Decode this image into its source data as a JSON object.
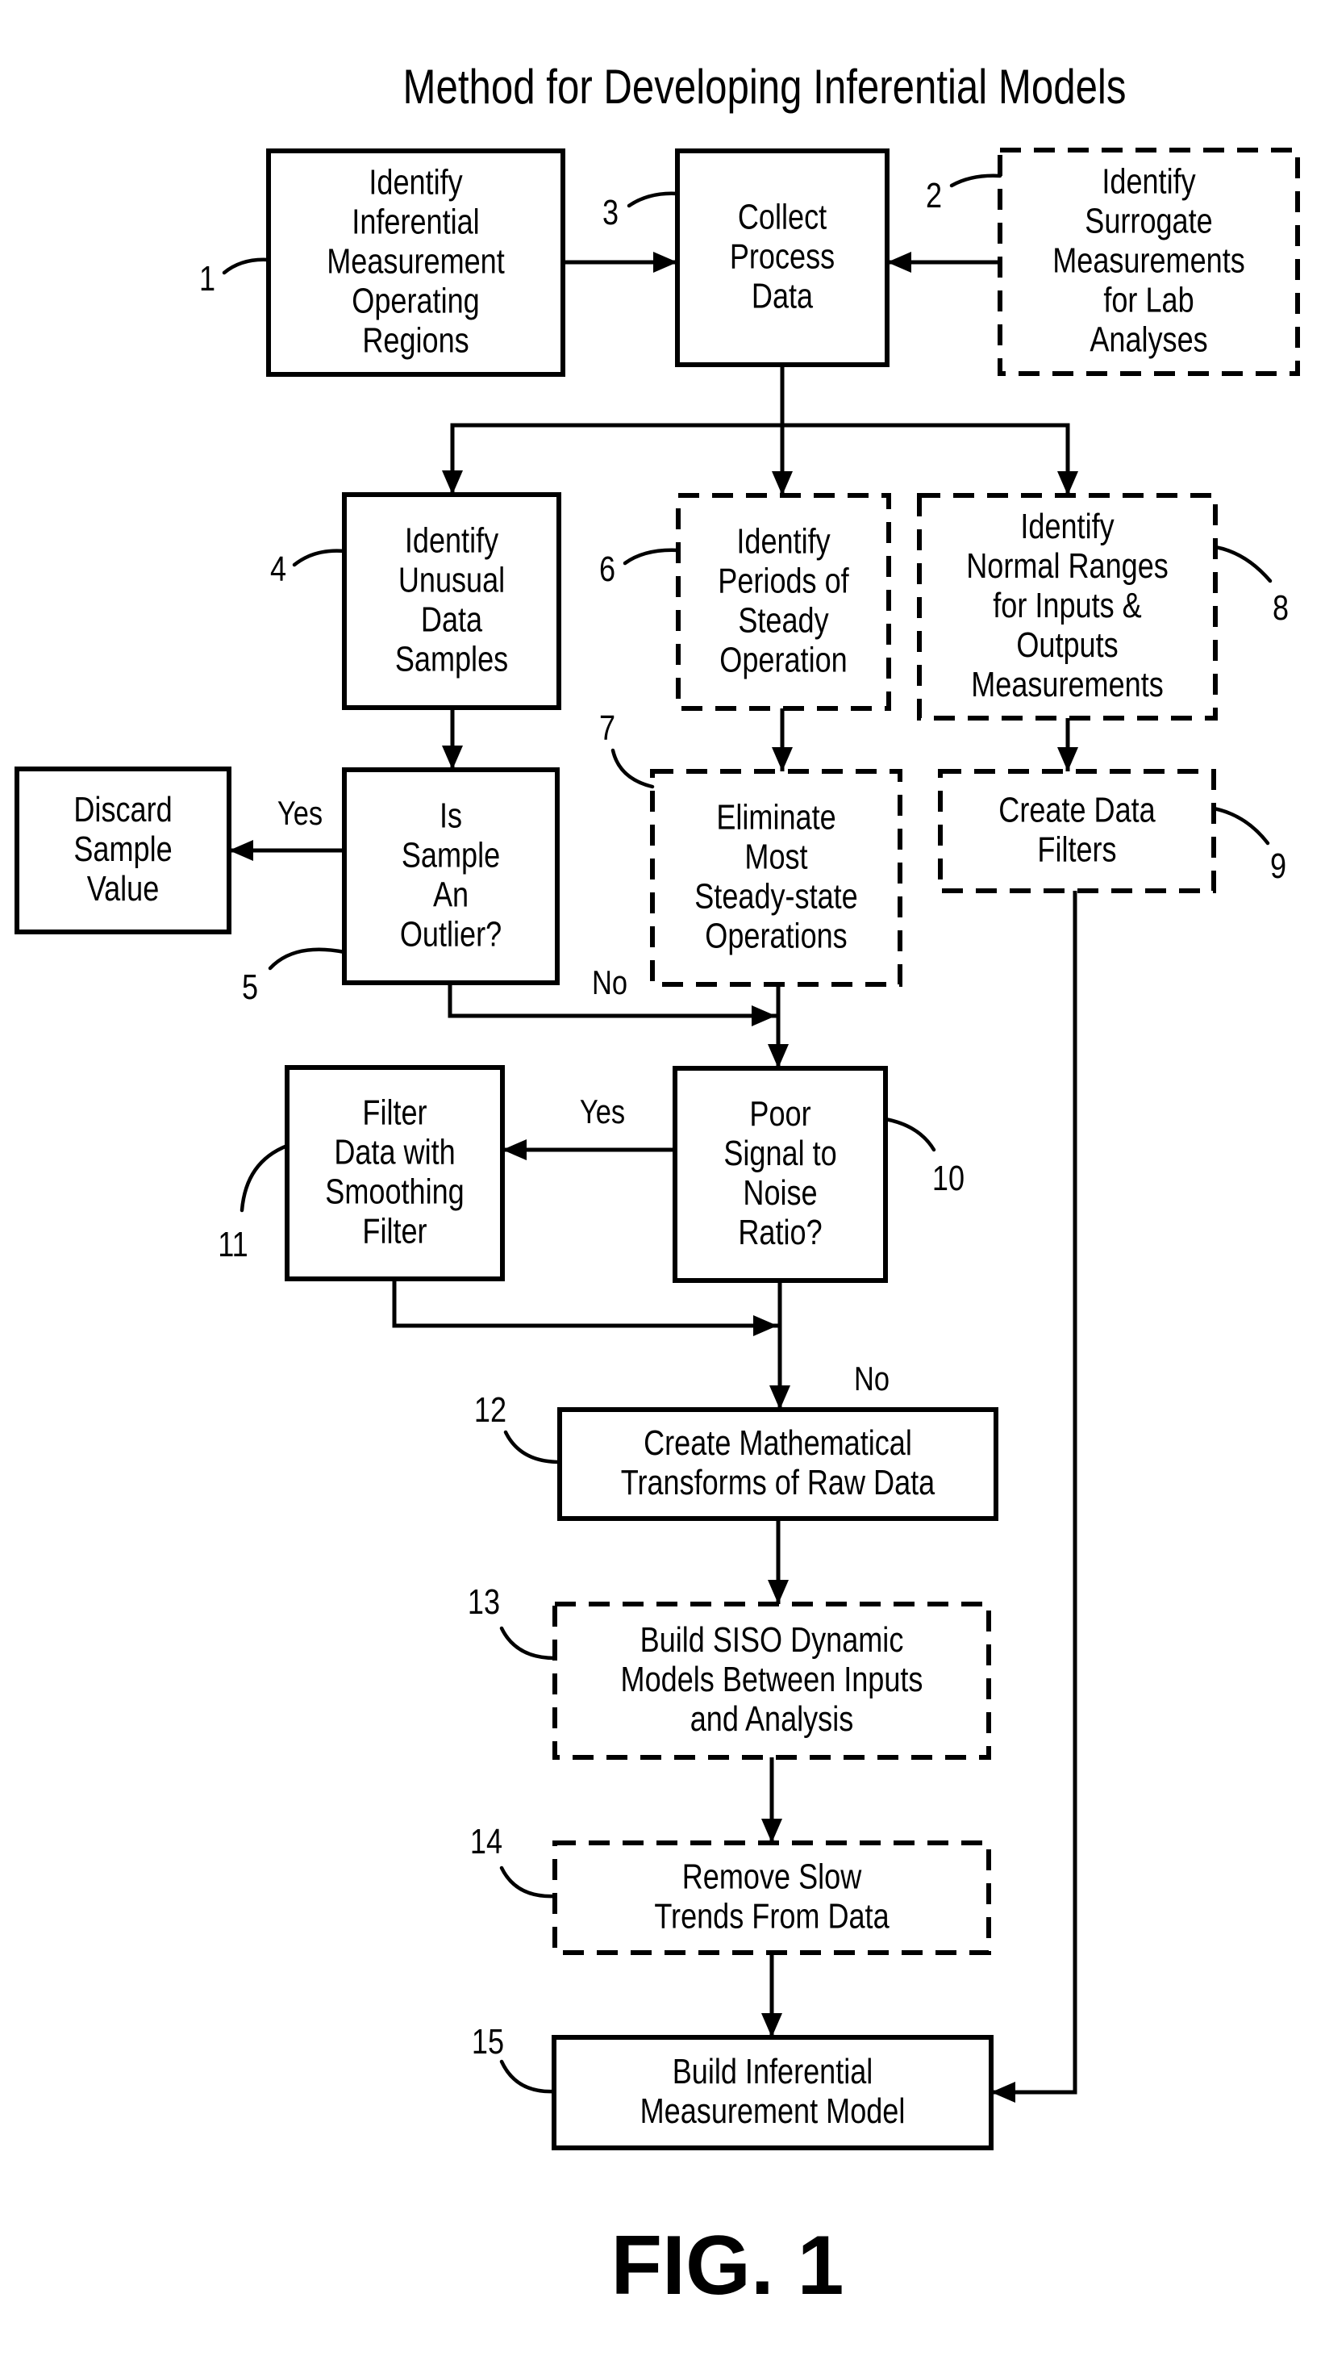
{
  "title": "Method for Developing Inferential Models",
  "figure_label": "FIG. 1",
  "steps": {
    "s1": {
      "number": "1",
      "style": "solid",
      "lines": [
        "Identify",
        "Inferential",
        "Measurement",
        "Operating",
        "Regions"
      ]
    },
    "s2": {
      "number": "2",
      "style": "dashed",
      "lines": [
        "Identify",
        "Surrogate",
        "Measurements",
        "for Lab",
        "Analyses"
      ]
    },
    "s3": {
      "number": "3",
      "style": "solid",
      "lines": [
        "Collect",
        "Process",
        "Data"
      ]
    },
    "s4": {
      "number": "4",
      "style": "solid",
      "lines": [
        "Identify",
        "Unusual",
        "Data",
        "Samples"
      ]
    },
    "s5": {
      "number": "5",
      "style": "solid",
      "type": "decision",
      "lines": [
        "Is",
        "Sample",
        "An",
        "Outlier?"
      ]
    },
    "s6": {
      "number": "6",
      "style": "dashed",
      "lines": [
        "Identify",
        "Periods of",
        "Steady",
        "Operation"
      ]
    },
    "s7": {
      "number": "7",
      "style": "dashed",
      "lines": [
        "Eliminate",
        "Most",
        "Steady-state",
        "Operations"
      ]
    },
    "s8": {
      "number": "8",
      "style": "dashed",
      "lines": [
        "Identify",
        "Normal Ranges",
        "for Inputs &",
        "Outputs",
        "Measurements"
      ]
    },
    "s9": {
      "number": "9",
      "style": "dashed",
      "lines": [
        "Create Data",
        "Filters"
      ]
    },
    "s10": {
      "number": "10",
      "style": "solid",
      "type": "decision",
      "lines": [
        "Poor",
        "Signal to",
        "Noise",
        "Ratio?"
      ]
    },
    "s11": {
      "number": "11",
      "style": "solid",
      "lines": [
        "Filter",
        "Data with",
        "Smoothing",
        "Filter"
      ]
    },
    "s12": {
      "number": "12",
      "style": "solid",
      "lines": [
        "Create Mathematical",
        "Transforms of Raw Data"
      ]
    },
    "s13": {
      "number": "13",
      "style": "dashed",
      "lines": [
        "Build SISO Dynamic",
        "Models Between Inputs",
        "and Analysis"
      ]
    },
    "s14": {
      "number": "14",
      "style": "dashed",
      "lines": [
        "Remove Slow",
        "Trends From Data"
      ]
    },
    "s15": {
      "number": "15",
      "style": "solid",
      "lines": [
        "Build Inferential",
        "Measurement Model"
      ]
    },
    "discard": {
      "number": "",
      "style": "solid",
      "lines": [
        "Discard",
        "Sample",
        "Value"
      ]
    }
  },
  "edges": [
    {
      "id": "e1",
      "from": "s1",
      "to": "s3",
      "label": ""
    },
    {
      "id": "e2",
      "from": "s2",
      "to": "s3",
      "label": ""
    },
    {
      "id": "e3",
      "from": "s3",
      "to": "s4",
      "label": ""
    },
    {
      "id": "e4",
      "from": "s3",
      "to": "s6",
      "label": ""
    },
    {
      "id": "e5",
      "from": "s3",
      "to": "s8",
      "label": ""
    },
    {
      "id": "e6",
      "from": "s4",
      "to": "s5",
      "label": ""
    },
    {
      "id": "e7",
      "from": "s6",
      "to": "s7",
      "label": ""
    },
    {
      "id": "e8",
      "from": "s8",
      "to": "s9",
      "label": ""
    },
    {
      "id": "e9",
      "from": "s5",
      "to": "discard",
      "label": "Yes"
    },
    {
      "id": "e10",
      "from": "s5",
      "to": "s10",
      "label": "No"
    },
    {
      "id": "e11",
      "from": "s7",
      "to": "s10",
      "label": ""
    },
    {
      "id": "e12",
      "from": "s10",
      "to": "s11",
      "label": "Yes"
    },
    {
      "id": "e13",
      "from": "s11",
      "to": "s12",
      "label": ""
    },
    {
      "id": "e14",
      "from": "s10",
      "to": "s12",
      "label": "No"
    },
    {
      "id": "e15",
      "from": "s12",
      "to": "s13",
      "label": ""
    },
    {
      "id": "e16",
      "from": "s13",
      "to": "s14",
      "label": ""
    },
    {
      "id": "e17",
      "from": "s14",
      "to": "s15",
      "label": ""
    },
    {
      "id": "e18",
      "from": "s9",
      "to": "s15",
      "label": ""
    }
  ]
}
